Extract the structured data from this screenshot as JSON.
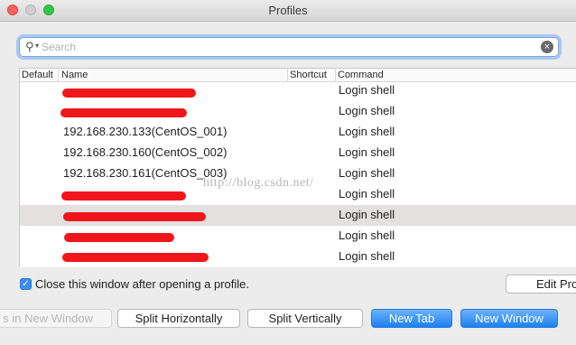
{
  "window": {
    "title": "Profiles"
  },
  "search": {
    "placeholder": "Search"
  },
  "table": {
    "columns": {
      "default": "Default",
      "name": "Name",
      "shortcut": "Shortcut",
      "command": "Command"
    },
    "rows": [
      {
        "name": "",
        "command": "Login shell",
        "redacted": true
      },
      {
        "name": "",
        "command": "Login shell",
        "redacted": true
      },
      {
        "name": "192.168.230.133(CentOS_001)",
        "command": "Login shell",
        "redacted": false
      },
      {
        "name": "192.168.230.160(CentOS_002)",
        "command": "Login shell",
        "redacted": false
      },
      {
        "name": "192.168.230.161(CentOS_003)",
        "command": "Login shell",
        "redacted": false
      },
      {
        "name": "",
        "command": "Login shell",
        "redacted": true
      },
      {
        "name": "",
        "command": "Login shell",
        "redacted": true,
        "selected": true
      },
      {
        "name": "",
        "command": "Login shell",
        "redacted": true
      },
      {
        "name": "",
        "command": "Login shell",
        "redacted": true
      }
    ]
  },
  "watermark": "http://blog.csdn.net/",
  "options": {
    "close_after_open": {
      "label": "Close this window after opening a profile.",
      "checked": true
    }
  },
  "buttons": {
    "edit_profiles": "Edit Pro",
    "tabs_in_new_window": "s in New Window",
    "split_horizontally": "Split Horizontally",
    "split_vertically": "Split Vertically",
    "new_tab": "New Tab",
    "new_window": "New Window"
  },
  "colors": {
    "accent": "#1e80f0",
    "redaction": "#f0161b",
    "selected_row": "#e4e0e0"
  },
  "icons": {
    "search": "search-icon",
    "clear": "clear-icon",
    "checkbox": "checkmark-icon"
  }
}
